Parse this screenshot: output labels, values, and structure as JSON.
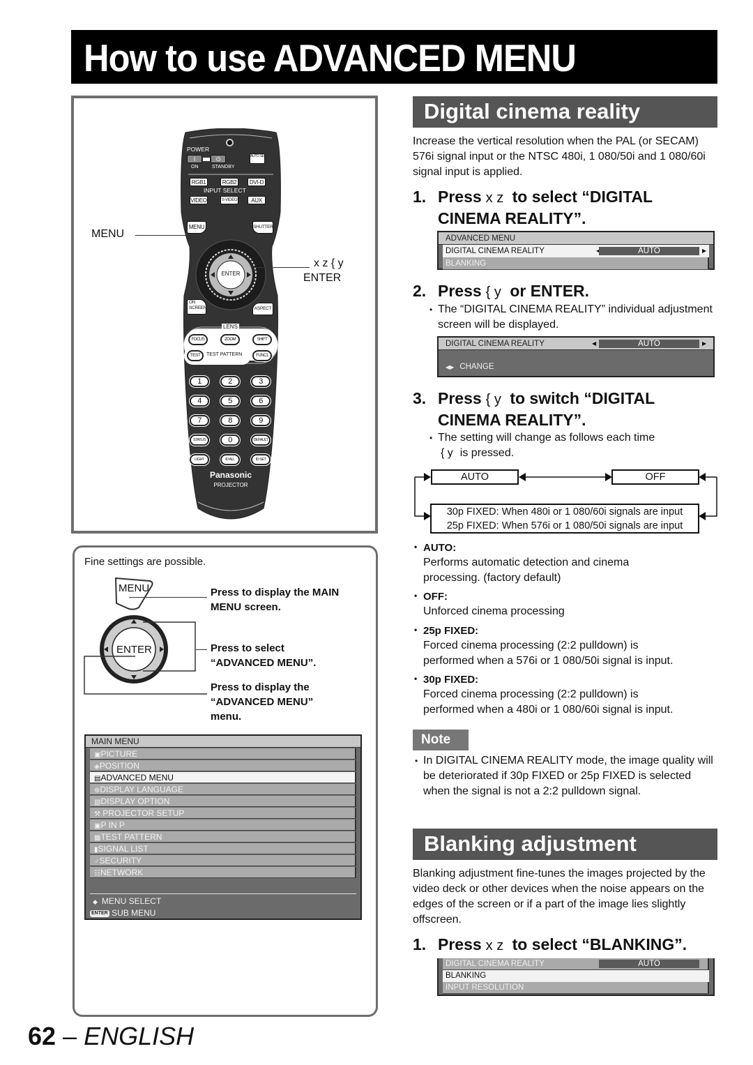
{
  "page_title": "How to use ADVANCED MENU",
  "remote": {
    "power_label": "POWER",
    "on_label": "ON",
    "standby_label": "STANDBY",
    "auto_setup_label": "AUTO SETUP",
    "input_buttons_row1": [
      "RGB1",
      "RGB2",
      "DVI-D"
    ],
    "input_select_label": "INPUT SELECT",
    "input_buttons_row2": [
      "VIDEO",
      "S-VIDEO",
      "AUX"
    ],
    "menu_button": "MENU",
    "shutter_button": "SHUTTER",
    "enter_button": "ENTER",
    "on_screen_button": "ON SCREEN",
    "aspect_button": "ASPECT",
    "lens_label": "LENS",
    "lens_buttons": [
      "FOCUS",
      "ZOOM",
      "SHIFT"
    ],
    "test_button": "TEST",
    "test_pattern_label": "TEST PATTERN",
    "func1_button": "FUNC1",
    "number_rows": [
      [
        "1",
        "2",
        "3"
      ],
      [
        "4",
        "5",
        "6"
      ],
      [
        "7",
        "8",
        "9"
      ],
      [
        "STATUS",
        "0",
        "DEFAULT"
      ],
      [
        "LIGHT",
        "ID ALL",
        "ID SET"
      ]
    ],
    "brand": "Panasonic",
    "brand_sub": "PROJECTOR",
    "callout_menu": "MENU",
    "callout_arrows": "x z { y",
    "callout_enter": "ENTER"
  },
  "instructions": {
    "intro": "Fine settings are possible.",
    "menu_key": "MENU",
    "enter_key": "ENTER",
    "step_menu": [
      "Press to display the MAIN",
      "MENU screen."
    ],
    "step_select": [
      "Press to select",
      "“ADVANCED MENU”."
    ],
    "step_display": [
      "Press to display the",
      "“ADVANCED MENU”",
      "menu."
    ]
  },
  "main_menu": {
    "title": "MAIN MENU",
    "items": [
      {
        "icon": "▣",
        "label": "PICTURE",
        "selected": false
      },
      {
        "icon": "◈",
        "label": "POSITION",
        "selected": false
      },
      {
        "icon": "▤",
        "label": "ADVANCED MENU",
        "selected": true
      },
      {
        "icon": "⊕",
        "label": "DISPLAY LANGUAGE",
        "selected": false
      },
      {
        "icon": "▧",
        "label": "DISPLAY OPTION",
        "selected": false
      },
      {
        "icon": "⚒",
        "label": " PROJECTOR SETUP",
        "selected": false
      },
      {
        "icon": "▣",
        "label": "P IN P",
        "selected": false
      },
      {
        "icon": "▦",
        "label": "TEST PATTERN",
        "selected": false
      },
      {
        "icon": "▮",
        "label": "SIGNAL LIST",
        "selected": false
      },
      {
        "icon": "♂",
        "label": "SECURITY",
        "selected": false
      },
      {
        "icon": "☷",
        "label": "NETWORK",
        "selected": false
      }
    ],
    "footer_select": "MENU SELECT",
    "footer_enter_chip": "ENTER",
    "footer_sub": "SUB MENU"
  },
  "dcr": {
    "heading": "Digital cinema reality",
    "intro": "Increase the vertical resolution when the PAL (or SECAM) 576i signal input or the NTSC 480i, 1 080/50i and 1 080/60i signal input is applied.",
    "step1": {
      "num": "1.",
      "press": "Press",
      "keys": "x z",
      "rest": "to select “DIGITAL",
      "line2": "CINEMA REALITY”."
    },
    "osd1": {
      "header": "ADVANCED MENU",
      "row_label": "DIGITAL CINEMA REALITY",
      "row_value": "AUTO",
      "next_row": "BLANKING"
    },
    "step2": {
      "num": "2.",
      "press": "Press",
      "keys": "{ y",
      "rest": "or ENTER."
    },
    "step2_bullet": "The “DIGITAL CINEMA REALITY” individual adjustment screen will be displayed.",
    "osd2": {
      "row_label": "DIGITAL CINEMA REALITY",
      "row_value": "AUTO",
      "footer": "CHANGE"
    },
    "step3": {
      "num": "3.",
      "press": "Press",
      "keys": "{ y",
      "rest": "to switch “DIGITAL",
      "line2": "CINEMA REALITY”."
    },
    "step3_bullet_line1": "The setting will change as follows each time",
    "step3_bullet_keys": "{ y",
    "step3_bullet_line2": "is pressed.",
    "flow": {
      "auto": "AUTO",
      "off": "OFF",
      "fixed_line1": "30p FIXED: When 480i or 1 080/60i signals are input",
      "fixed_line2": "25p FIXED: When 576i or 1 080/50i signals are input"
    },
    "definitions": [
      {
        "term": "AUTO:",
        "text": [
          "Performs automatic detection and cinema",
          "processing. (factory default)"
        ]
      },
      {
        "term": "OFF:",
        "text": [
          "Unforced cinema processing"
        ]
      },
      {
        "term": "25p FIXED:",
        "text": [
          "Forced cinema processing (2:2 pulldown) is",
          "performed when a 576i or 1 080/50i signal is input."
        ]
      },
      {
        "term": "30p FIXED:",
        "text": [
          "Forced cinema processing (2:2 pulldown) is",
          "performed when a 480i or 1 080/60i signal is input."
        ]
      }
    ],
    "note_label": "Note",
    "note_text": "In DIGITAL CINEMA REALITY mode, the image quality will be deteriorated if 30p FIXED or 25p FIXED is selected when the signal is not a 2:2 pulldown signal."
  },
  "blanking": {
    "heading": "Blanking adjustment",
    "intro": "Blanking adjustment fine-tunes the images projected by the video deck or other devices when the noise appears on the edges of the screen or if a part of the image lies slightly offscreen.",
    "step1": {
      "num": "1.",
      "press": "Press",
      "keys": "x z",
      "rest": "to select “BLANKING”."
    },
    "osd": {
      "row1_label": "DIGITAL CINEMA REALITY",
      "row1_value": "AUTO",
      "row2_label": "BLANKING",
      "row3_label": "INPUT RESOLUTION"
    }
  },
  "footer": {
    "page_number": "62",
    "dash": " – ",
    "language": "ENGLISH"
  }
}
